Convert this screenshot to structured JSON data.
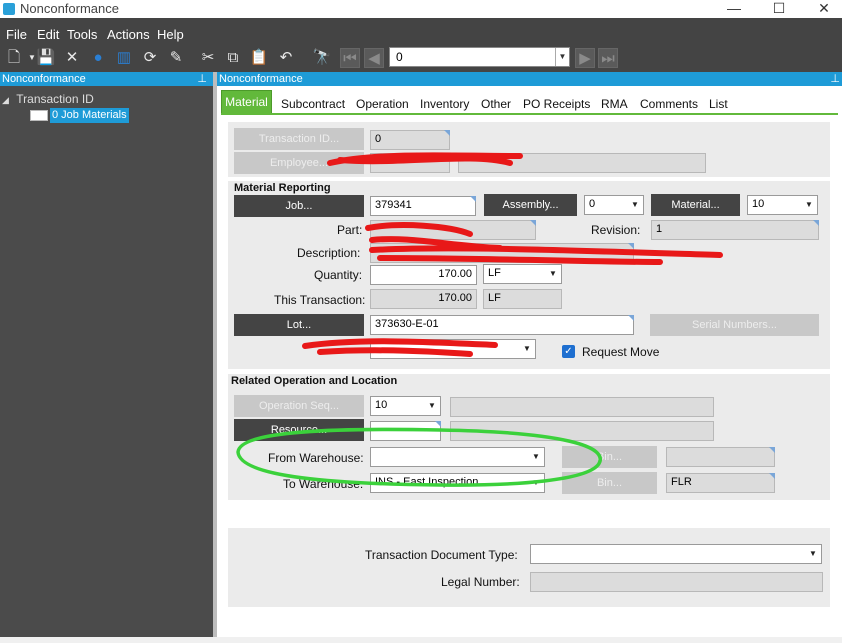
{
  "window": {
    "title": "Nonconformance",
    "minimize": "—",
    "maximize": "☐",
    "close": "✕"
  },
  "menu": [
    "File",
    "Edit",
    "Tools",
    "Actions",
    "Help"
  ],
  "toolbar": {
    "nav_value": "0"
  },
  "left_panel": {
    "header": "Nonconformance",
    "tree_root": "Transaction ID",
    "tree_child": "0 Job Materials"
  },
  "main_panel": {
    "header": "Nonconformance"
  },
  "tabs": [
    "Material",
    "Subcontract",
    "Operation",
    "Inventory",
    "Other",
    "PO Receipts",
    "RMA",
    "Comments",
    "List"
  ],
  "top": {
    "transaction_id_btn": "Transaction ID...",
    "transaction_id_value": "0",
    "employee_btn": "Employee..."
  },
  "material_reporting": {
    "header": "Material Reporting",
    "job_btn": "Job...",
    "job_value": "379341",
    "assembly_btn": "Assembly...",
    "assembly_value": "0",
    "material_btn": "Material...",
    "material_value": "10",
    "part_label": "Part:",
    "revision_label": "Revision:",
    "revision_value": "1",
    "description_label": "Description:",
    "quantity_label": "Quantity:",
    "quantity_value": "170.00",
    "quantity_uom": "LF",
    "this_txn_label": "This Transaction:",
    "this_txn_value": "170.00",
    "this_txn_uom": "LF",
    "lot_btn": "Lot...",
    "lot_value": "373630-E-01",
    "serial_btn": "Serial Numbers...",
    "request_move_label": "Request Move"
  },
  "related_operation": {
    "header": "Related Operation and Location",
    "opseq_btn": "Operation Seq...",
    "opseq_value": "10",
    "resource_btn": "Resource...",
    "from_wh_label": "From Warehouse:",
    "from_bin_btn": "Bin...",
    "to_wh_label": "To Warehouse:",
    "to_wh_value": "INS - East Inspection",
    "to_bin_btn": "Bin...",
    "to_bin_value": "FLR"
  },
  "legal": {
    "doc_type_label": "Transaction Document Type:",
    "legal_number_label": "Legal Number:"
  },
  "colors": {
    "accent": "#1e9bd7",
    "tab_active": "#62b93b",
    "dark": "#444444",
    "highlight": "#3bd13b"
  }
}
